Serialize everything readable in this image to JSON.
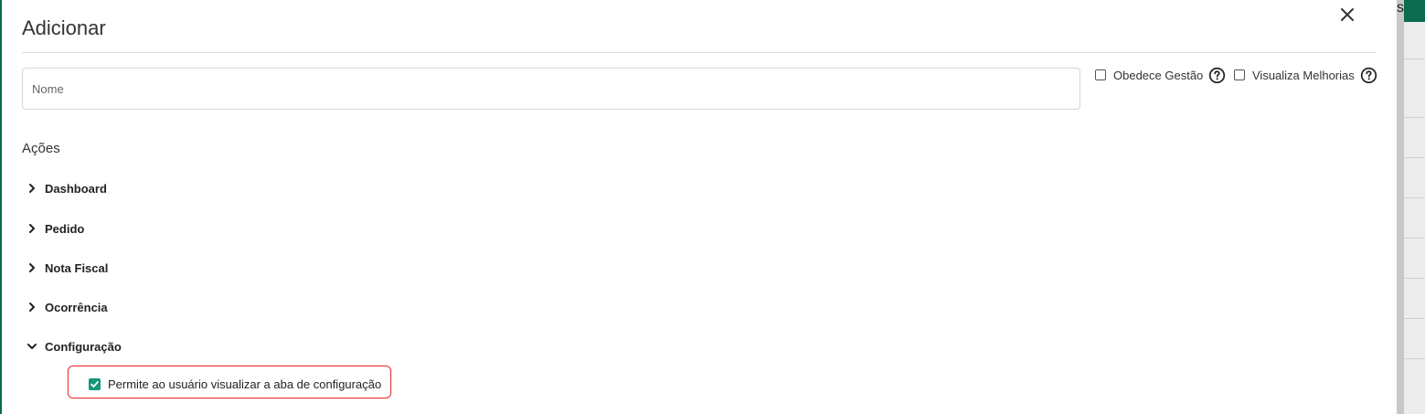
{
  "modal": {
    "title": "Adicionar",
    "close_icon": "close-icon"
  },
  "form": {
    "name_placeholder": "Nome",
    "name_value": "",
    "options": [
      {
        "label": "Obedece Gestão",
        "checked": false,
        "icon": "help-circle-icon"
      },
      {
        "label": "Visualiza Melhorias",
        "checked": false,
        "icon": "help-circle-icon"
      }
    ]
  },
  "actions": {
    "title": "Ações",
    "items": [
      {
        "label": "Dashboard",
        "expanded": false,
        "icon": "chevron-right-icon"
      },
      {
        "label": "Pedido",
        "expanded": false,
        "icon": "chevron-right-icon"
      },
      {
        "label": "Nota Fiscal",
        "expanded": false,
        "icon": "chevron-right-icon"
      },
      {
        "label": "Ocorrência",
        "expanded": false,
        "icon": "chevron-right-icon"
      },
      {
        "label": "Configuração",
        "expanded": true,
        "icon": "chevron-down-icon"
      }
    ],
    "configuracao_children": [
      {
        "label": "Permite ao usuário visualizar a aba de configuração",
        "checked": true
      }
    ]
  },
  "background": {
    "partial_text": "s"
  },
  "colors": {
    "accent": "#15967a",
    "brand": "#0b6b4f",
    "highlight": "#e53935"
  }
}
